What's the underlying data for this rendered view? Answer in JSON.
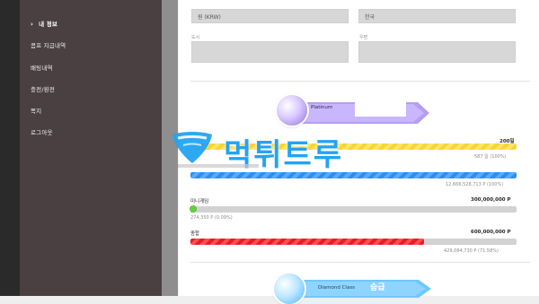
{
  "sidebar": {
    "items": [
      {
        "label": "내 정보",
        "active": true
      },
      {
        "label": "콤프 지급내역",
        "active": false
      },
      {
        "label": "배팅내역",
        "active": false
      },
      {
        "label": "충전/환전",
        "active": false
      },
      {
        "label": "쪽지",
        "active": false
      },
      {
        "label": "로그아웃",
        "active": false
      }
    ]
  },
  "profile": {
    "currency_value": "원 (KRW)",
    "country_value": "한국",
    "city_label": "도시",
    "zip_label": "우편",
    "city_value": "",
    "zip_value": ""
  },
  "vip": {
    "tier": "Platinum",
    "meters": [
      {
        "right_label": "200일",
        "sub_label": "587 일 (100%)",
        "fill_percent": 100,
        "color": "#f7d43a"
      },
      {
        "sub_label": "12,666,528,713 P (100%)",
        "fill_percent": 100,
        "color": "#2d8ef0"
      },
      {
        "left_label": "미니게임",
        "right_label": "300,000,000 P",
        "sub_label": "274,350 P (0.09%)",
        "fill_percent": 0.09,
        "color": "#66d13b"
      },
      {
        "left_label": "종합",
        "right_label": "600,000,000 P",
        "sub_label": "429,084,730 P (71.58%)",
        "fill_percent": 71.58,
        "color": "#e81c23"
      }
    ]
  },
  "next_tier": {
    "label": "Diamond Class",
    "action": "승급"
  },
  "watermark": {
    "text": "먹튀트루"
  }
}
